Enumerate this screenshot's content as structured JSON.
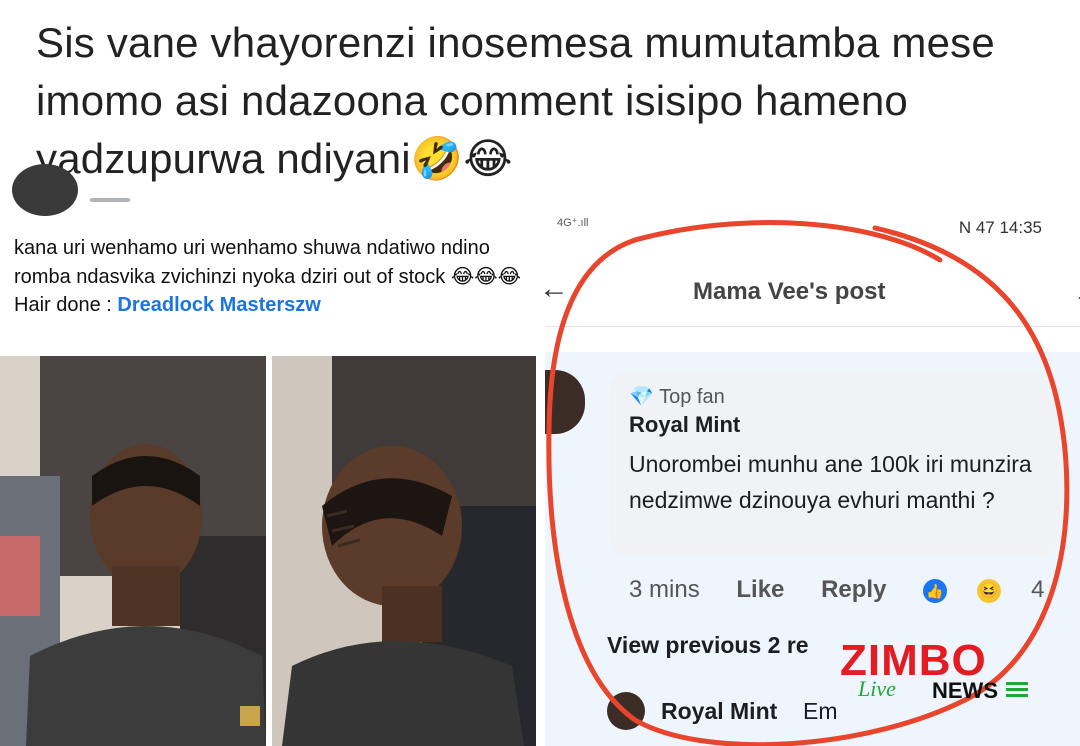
{
  "caption": {
    "text": "Sis vane vhayorenzi inosemesa mumutamba mese imomo asi ndazoona comment isisipo hameno yadzupurwa ndiyani",
    "emojis": [
      "🤣",
      "😂"
    ]
  },
  "left_post": {
    "body": "kana uri wenhamo uri wenhamo shuwa ndatiwo ndino romba ndasvika zvichinzi nyoka dziri out of stock",
    "body_emojis": "😂😂😂",
    "hair_label": "Hair done : ",
    "hair_link": "Dreadlock Masterszw",
    "icons": [
      "avatar",
      "globe-icon"
    ]
  },
  "phone": {
    "status": {
      "signal": "4G⁺.ıll",
      "right": "N 47 14:35"
    },
    "nav": {
      "back_icon": "←",
      "title": "Mama Vee's post",
      "search_icon": "search-icon"
    },
    "comment": {
      "badge": "Top fan",
      "badge_icon": "💎",
      "author": "Royal Mint",
      "text": "Unorombei munhu ane 100k iri munzira nedzimwe dzinouya evhuri manthi ?",
      "time": "3 mins",
      "like": "Like",
      "reply": "Reply",
      "reaction_count": "4"
    },
    "view_previous": "View previous 2 re",
    "reply": {
      "author": "Royal Mint",
      "snippet": "Em"
    }
  },
  "watermark": {
    "brand": "ZIMBO",
    "live": "Live",
    "news": "NEWS",
    "colors": {
      "red": "#e31b23",
      "green": "#1ea838"
    }
  },
  "accent_colors": {
    "link": "#1b74e4",
    "circle": "#e8452c",
    "like": "#1877f2"
  }
}
